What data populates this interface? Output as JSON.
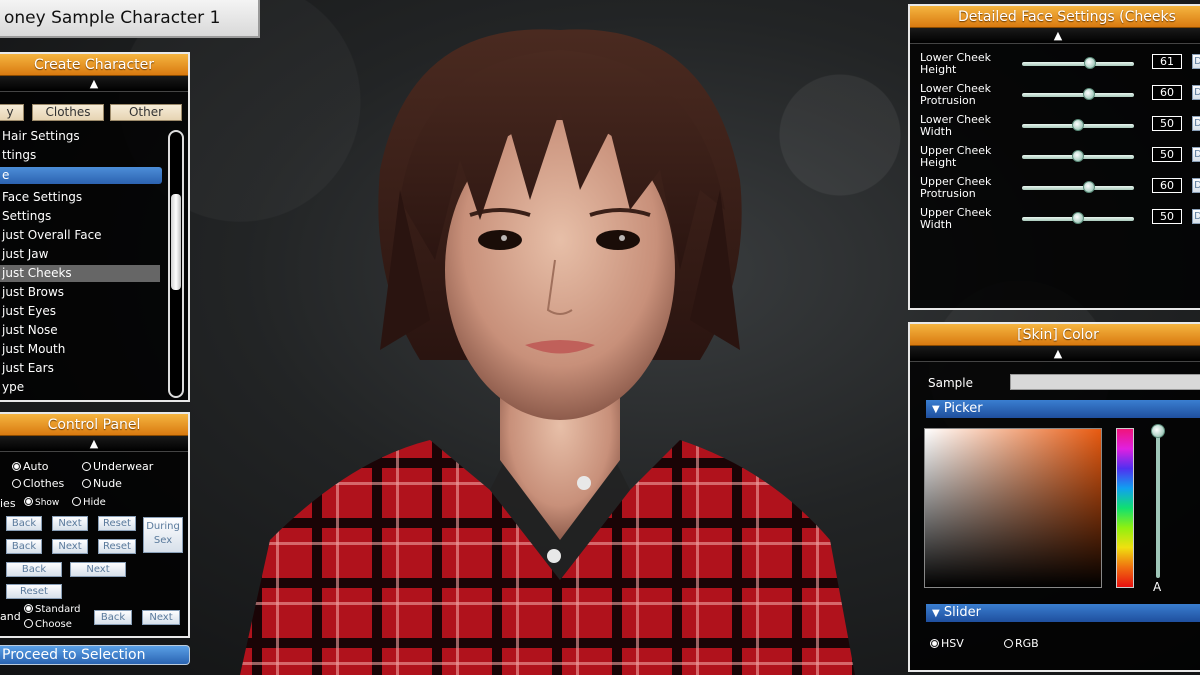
{
  "title": "oney Sample Character 1",
  "create_panel": {
    "header": "Create Character",
    "tabs": [
      "y",
      "Clothes",
      "Other"
    ],
    "menu": [
      "Hair Settings",
      "ttings",
      "e",
      " Face Settings",
      " Settings",
      "just Overall Face",
      "just Jaw",
      "just Cheeks",
      "just Brows",
      "just Eyes",
      "just Nose",
      "just Mouth",
      "just Ears",
      "ype"
    ]
  },
  "control_panel": {
    "header": "Control Panel",
    "opt_auto": "Auto",
    "opt_underwear": "Underwear",
    "opt_clothes": "Clothes",
    "opt_nude": "Nude",
    "ies_label": "ies",
    "opt_show": "Show",
    "opt_hide": "Hide",
    "back": "Back",
    "next": "Next",
    "reset": "Reset",
    "during_sex": "During Sex",
    "and_label": "and",
    "opt_standard": "Standard",
    "opt_choose": "Choose"
  },
  "proceed_label": "Proceed to Selection",
  "face_panel": {
    "header": "Detailed Face Settings (Cheeks",
    "edge_btn": "D",
    "sliders": [
      {
        "label_1": "Lower Cheek",
        "label_2": "Height",
        "value": "61",
        "pct": 0.61
      },
      {
        "label_1": "Lower Cheek",
        "label_2": "Protrusion",
        "value": "60",
        "pct": 0.6
      },
      {
        "label_1": "Lower Cheek",
        "label_2": "Width",
        "value": "50",
        "pct": 0.5
      },
      {
        "label_1": "Upper Cheek",
        "label_2": "Height",
        "value": "50",
        "pct": 0.5
      },
      {
        "label_1": "Upper Cheek",
        "label_2": "Protrusion",
        "value": "60",
        "pct": 0.6
      },
      {
        "label_1": "Upper Cheek",
        "label_2": "Width",
        "value": "50",
        "pct": 0.5
      }
    ]
  },
  "skin_panel": {
    "header": "[Skin] Color",
    "sample_label": "Sample",
    "picker_label": "Picker",
    "slider_label": "Slider",
    "alpha_label": "A",
    "hsv": "HSV",
    "rgb": "RGB"
  },
  "colors": {
    "accent_orange": "#e08a1a",
    "accent_blue": "#2c62b0"
  }
}
